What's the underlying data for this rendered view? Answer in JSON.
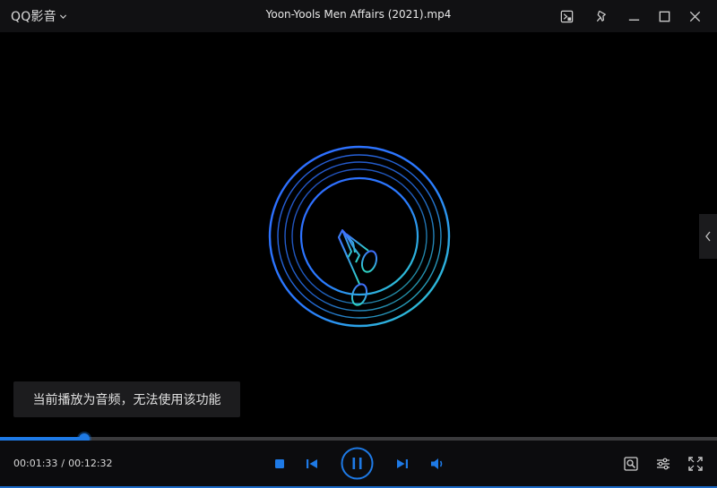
{
  "app": {
    "name": "QQ影音",
    "file_title": "Yoon-Yools Men Affairs (2021).mp4"
  },
  "titlebar": {
    "buttons": [
      "screenshot-icon",
      "pin-icon",
      "minimize-icon",
      "maximize-icon",
      "close-icon"
    ]
  },
  "notice": {
    "text": "当前播放为音频，无法使用该功能"
  },
  "playback": {
    "current_time": "00:01:33",
    "separator": "/",
    "total_time": "00:12:32",
    "progress_percent": 11.7,
    "state": "playing"
  },
  "colors": {
    "accent": "#1e7ae6",
    "background": "#000000",
    "titlebar": "#111113",
    "control_bar": "#0c0c0e",
    "disc_cyan": "#2fd6c6",
    "disc_blue": "#2f6bff"
  },
  "controls": {
    "buttons": [
      "stop-icon",
      "previous-icon",
      "pause-icon",
      "next-icon",
      "volume-icon",
      "video-tools-icon",
      "settings-icon",
      "fullscreen-icon"
    ]
  }
}
